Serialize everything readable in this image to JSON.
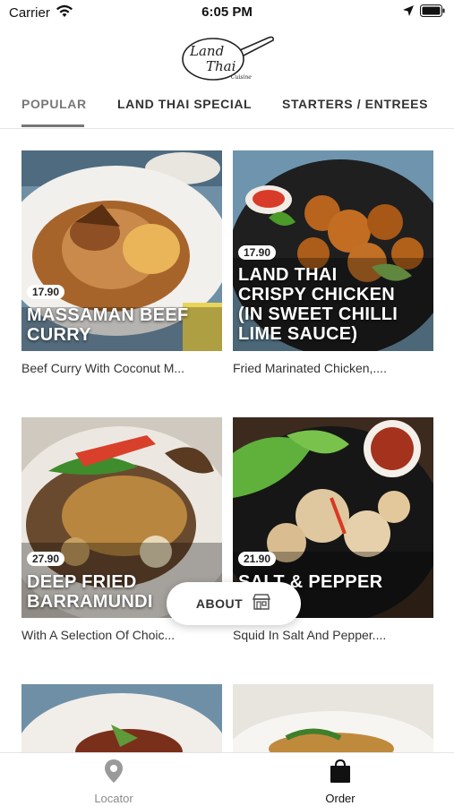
{
  "status": {
    "carrier": "Carrier",
    "time": "6:05 PM"
  },
  "logo": {
    "line1": "Land",
    "line2": "Thai",
    "line3": "Cuisine"
  },
  "tabs": [
    {
      "label": "POPULAR",
      "active": true
    },
    {
      "label": "LAND THAI SPECIAL",
      "active": false
    },
    {
      "label": "STARTERS / ENTREES",
      "active": false
    }
  ],
  "items": [
    {
      "price": "17.90",
      "title_lines": [
        "MASSAMAN BEEF",
        "CURRY"
      ],
      "description": "Beef Curry With Coconut M..."
    },
    {
      "price": "17.90",
      "title_lines": [
        "LAND THAI",
        "CRISPY CHICKEN",
        "(IN SWEET CHILLI",
        "LIME SAUCE)"
      ],
      "description": "Fried Marinated Chicken,...."
    },
    {
      "price": "27.90",
      "title_lines": [
        "DEEP FRIED",
        "BARRAMUNDI"
      ],
      "description": "With A Selection Of Choic..."
    },
    {
      "price": "21.90",
      "title_lines": [
        "SALT & PEPPER"
      ],
      "description": "Squid In Salt And Pepper...."
    }
  ],
  "about": {
    "label": "ABOUT"
  },
  "bottom_nav": [
    {
      "label": "Locator",
      "icon": "location-pin-icon",
      "active": false
    },
    {
      "label": "Order",
      "icon": "shopping-bag-icon",
      "active": true
    }
  ],
  "colors": {
    "text": "#222222",
    "muted": "#8a8a8a",
    "tab_active": "#777777"
  }
}
